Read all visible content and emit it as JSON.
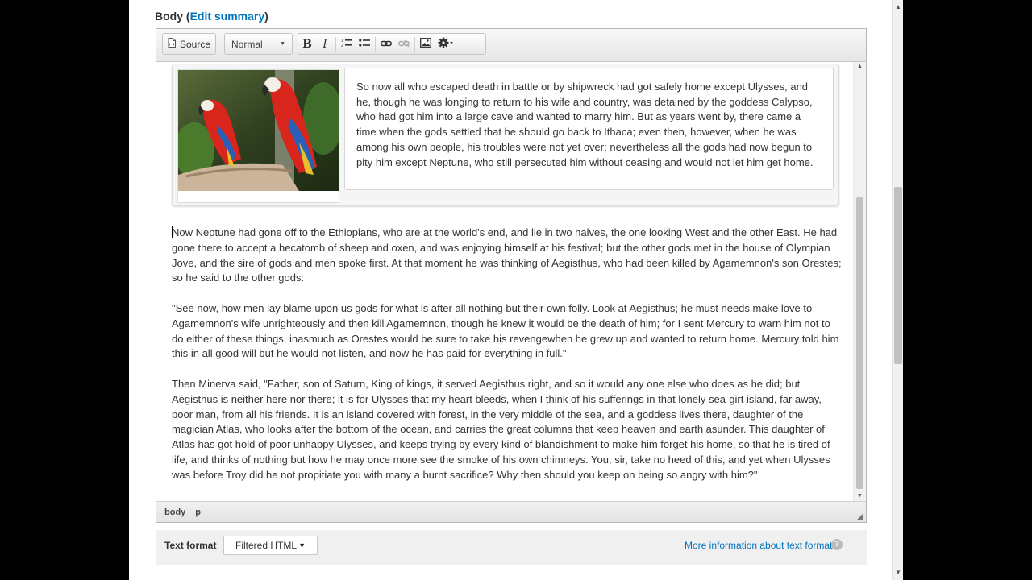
{
  "field": {
    "label": "Body",
    "open_paren": "(",
    "edit_summary_link": "Edit summary",
    "close_paren": ")"
  },
  "toolbar": {
    "source_label": "Source",
    "format_value": "Normal",
    "bold_label": "B",
    "italic_label": "I"
  },
  "caption_text": "So now all who escaped death in battle or by shipwreck had got safely home except Ulysses, and he, though he was longing to return to his wife and country, was detained by the goddess Calypso, who had got him into a large cave and wanted to marry him. But as years went by, there came a time when the gods settled that he should go back to Ithaca; even then, however, when he was among his own people, his troubles were not yet over; nevertheless all the gods had now begun to pity him except Neptune, who still persecuted him without ceasing and would not let him get home.",
  "paragraphs": [
    "Now Neptune had gone off to the Ethiopians, who are at the world's end, and lie in two halves, the one looking West and the other East. He had gone there to accept a hecatomb of sheep and oxen, and was enjoying himself at his festival; but the other gods met in the house of Olympian Jove, and the sire of gods and men spoke first. At that moment he was thinking of Aegisthus, who had been killed by Agamemnon's son Orestes; so he said to the other gods:",
    "\"See now, how men lay blame upon us gods for what is after all nothing but their own folly. Look at Aegisthus; he must needs make love to Agamemnon's wife unrighteously and then kill Agamemnon, though he knew it would be the death of him; for I sent Mercury to warn him not to do either of these things, inasmuch as Orestes would be sure to take his revengewhen he grew up and wanted to return home. Mercury told him this in all good will but he would not listen, and now he has paid for everything in full.\"",
    "Then Minerva said, \"Father, son of Saturn, King of kings, it served Aegisthus right, and so it would any one else who does as he did; but Aegisthus is neither here nor there; it is for Ulysses that my heart bleeds, when I think of his sufferings in that lonely sea-girt island, far away, poor man, from all his friends. It is an island covered with forest, in the very middle of the sea, and a goddess lives there, daughter of the magician Atlas, who looks after the bottom of the ocean, and carries the great columns that keep heaven and earth asunder. This daughter of Atlas has got hold of poor unhappy Ulysses, and keeps trying by every kind of blandishment to make him forget his home, so that he is tired of life, and thinks of nothing but how he may once more see the smoke of his own chimneys. You, sir, take no heed of this, and yet when Ulysses was before Troy did he not propitiate you with many a burnt sacrifice? Why then should you keep on being so angry with him?\""
  ],
  "pathbar": {
    "items": [
      "body",
      "p"
    ]
  },
  "text_format": {
    "label": "Text format",
    "selected": "Filtered HTML",
    "help_link": "More information about text formats",
    "help_glyph": "?"
  },
  "colors": {
    "link": "#0074bd",
    "parrot_red": "#d8261c"
  }
}
